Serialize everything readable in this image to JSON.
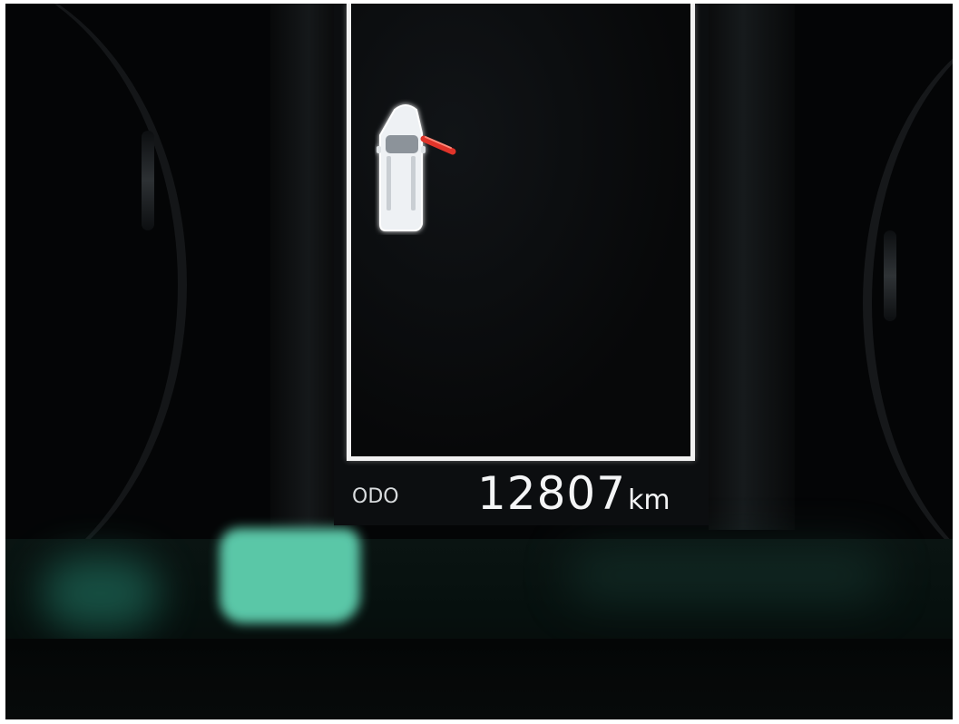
{
  "cluster": {
    "odometer": {
      "label": "ODO",
      "value": "12807",
      "unit": "km"
    },
    "vehicle_icon": "car-top-view-icon",
    "warning_indicator": "open-door-icon"
  },
  "colors": {
    "display_frame": "#f1f1f1",
    "text": "#f4f5f6",
    "warning": "#e0342a",
    "dashboard_glow": "#5fd1b0"
  }
}
